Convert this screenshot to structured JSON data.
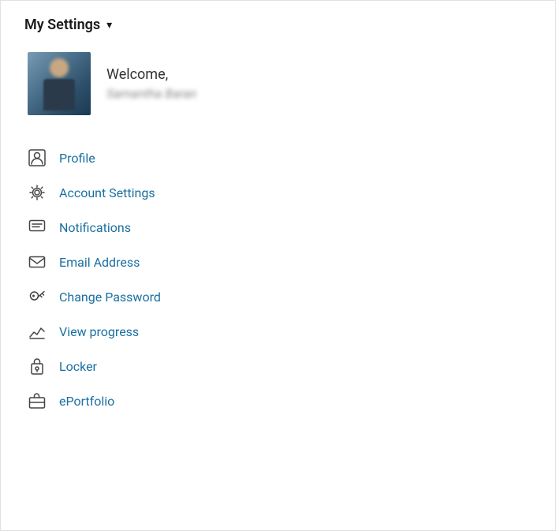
{
  "header": {
    "title": "My Settings",
    "chevron": "▾"
  },
  "profile": {
    "welcome": "Welcome,",
    "username": "Samantha Baran"
  },
  "nav": {
    "items": [
      {
        "id": "profile",
        "label": "Profile",
        "icon": "person"
      },
      {
        "id": "account-settings",
        "label": "Account Settings",
        "icon": "gear"
      },
      {
        "id": "notifications",
        "label": "Notifications",
        "icon": "chat"
      },
      {
        "id": "email-address",
        "label": "Email Address",
        "icon": "envelope"
      },
      {
        "id": "change-password",
        "label": "Change Password",
        "icon": "key"
      },
      {
        "id": "view-progress",
        "label": "View progress",
        "icon": "chart"
      },
      {
        "id": "locker",
        "label": "Locker",
        "icon": "locker"
      },
      {
        "id": "eportfolio",
        "label": "ePortfolio",
        "icon": "briefcase"
      }
    ]
  }
}
